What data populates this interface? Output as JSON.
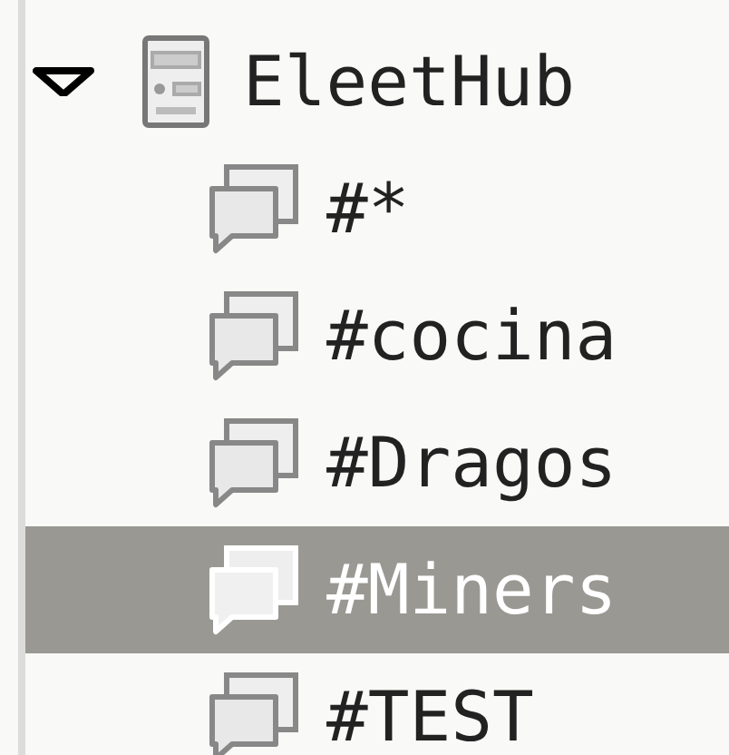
{
  "tree": [
    {
      "label": "EleetHub",
      "kind": "server",
      "expanded": true,
      "selected": false,
      "children": [
        {
          "label": "#*",
          "kind": "channel",
          "selected": false
        },
        {
          "label": "#cocina",
          "kind": "channel",
          "selected": false
        },
        {
          "label": "#Dragos",
          "kind": "channel",
          "selected": false
        },
        {
          "label": "#Miners",
          "kind": "channel",
          "selected": true
        },
        {
          "label": "#TEST",
          "kind": "channel",
          "selected": false
        }
      ]
    }
  ]
}
